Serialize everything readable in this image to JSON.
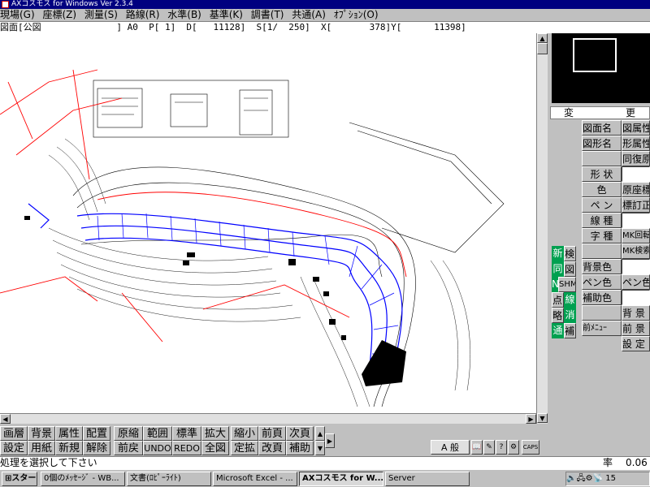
{
  "window": {
    "title": "AXコスモス for Windows Ver 2.3.4"
  },
  "menu": [
    "現場(G)",
    "座標(Z)",
    "測量(S)",
    "路線(R)",
    "水準(B)",
    "基準(K)",
    "調書(T)",
    "共通(A)",
    "ｵﾌﾟｼｮﾝ(O)"
  ],
  "status": {
    "text": "図面[公図              ] A0  P[ 1]  D[   11128]  S[1/  250]  X[       378]Y[      11398]"
  },
  "panel": {
    "header": [
      "変",
      "更"
    ],
    "row_labels": [
      "図面名",
      "図形名",
      "",
      "形 状",
      "色",
      "ペ ン",
      "線 種",
      "字 種",
      "",
      "背景色",
      "ペン色",
      "補助色",
      "",
      "",
      "前ﾒﾆｭｰ"
    ],
    "row_values": [
      "図属性",
      "形属性",
      "同復原",
      "",
      "原座標",
      "標訂正",
      "",
      "MK回転",
      "MK検索",
      "",
      "ペン色",
      "",
      "背 景",
      "前 景",
      "設 定"
    ],
    "left_keys": [
      "新",
      "同",
      "N",
      "点",
      "略",
      "通"
    ],
    "left_keys2": [
      "検",
      "図",
      "SHM",
      "線",
      "消",
      "補"
    ]
  },
  "toolbar": {
    "row1": [
      "画層",
      "背景",
      "属性",
      "配置",
      "原縮",
      "範囲",
      "標準",
      "拡大",
      "縮小",
      "前頁",
      "次頁"
    ],
    "row2": [
      "設定",
      "用紙",
      "新規",
      "解除",
      "前戻",
      "UNDO",
      "REDO",
      "全図",
      "定拡",
      "改頁",
      "補助"
    ],
    "ime": "A 般"
  },
  "message": {
    "prompt": "処理を選択して下さい",
    "scale_label": "率",
    "scale_value": "0.06"
  },
  "taskbar": {
    "start": "スタート",
    "tasks": [
      "0個のﾒｯｾｰｼﾞ - WB...",
      "文書(ﾛﾋﾟｰﾗｲﾄ)",
      "Microsoft Excel - ...",
      "AXコスモス for W...",
      "Server"
    ],
    "clock": "15"
  },
  "colors": {
    "contour": "#000000",
    "highlight": "#0000ff",
    "redline": "#ff0000",
    "green": "#00a050"
  }
}
